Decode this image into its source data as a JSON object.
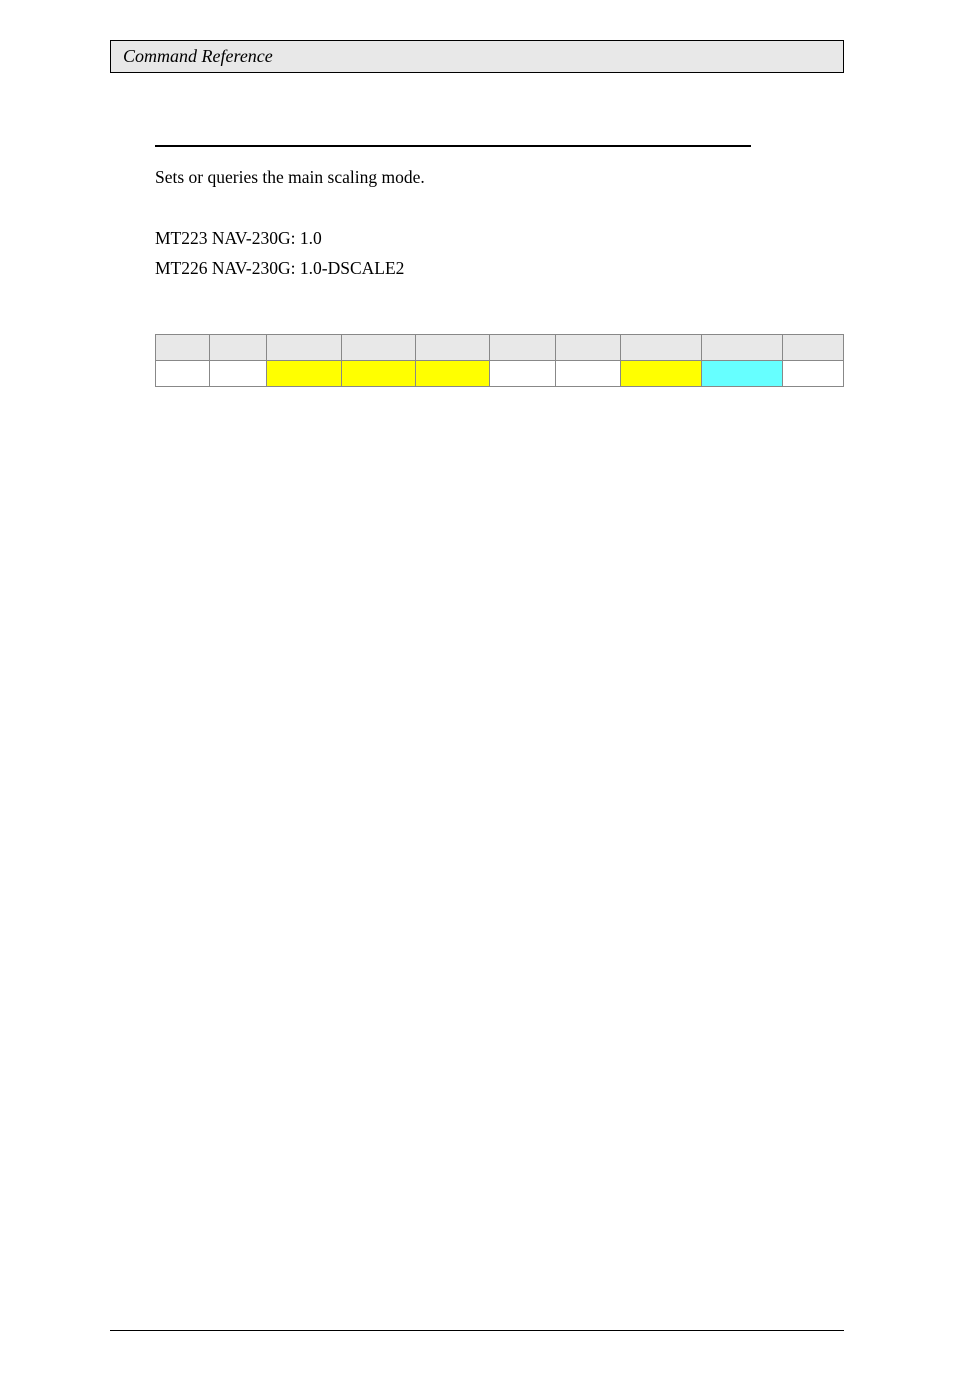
{
  "header": {
    "title": "Command Reference"
  },
  "section": {
    "description": "Sets or queries the main scaling mode.",
    "spec1": "MT223 NAV-230G: 1.0",
    "spec2": "MT226 NAV-230G: 1.0-DSCALE2"
  },
  "table": {
    "colors": {
      "highlight_yellow": "#ffff00",
      "highlight_cyan": "#66ffff",
      "header_bg": "#e8e8e8"
    }
  }
}
